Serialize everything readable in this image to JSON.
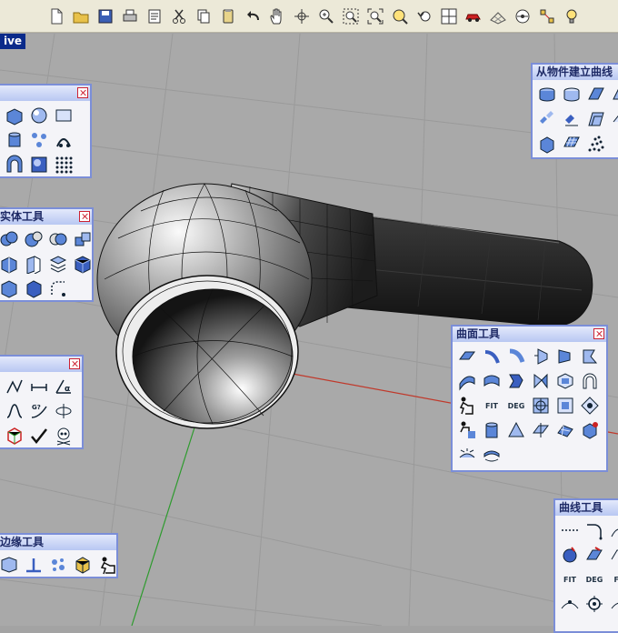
{
  "viewport": {
    "label": "ive"
  },
  "toolbar": {
    "icons": [
      "new-file",
      "open-folder",
      "save",
      "print",
      "properties",
      "cut",
      "copy",
      "paste",
      "undo",
      "pan-hand",
      "rotate-view",
      "zoom-in",
      "zoom-window",
      "zoom-extents",
      "zoom-selected",
      "undo-view",
      "four-viewports",
      "car",
      "grid-snap",
      "record-history",
      "select-points",
      "light-bulb"
    ]
  },
  "palettes": {
    "left1": {
      "title": ""
    },
    "solid": {
      "title": "实体工具"
    },
    "left3": {
      "title": ""
    },
    "edge": {
      "title": "边缘工具"
    },
    "from_object": {
      "title": "从物件建立曲线"
    },
    "surface": {
      "title": "曲面工具",
      "labels": {
        "fit": "FIT",
        "deg": "DEG"
      }
    },
    "curve": {
      "title": "曲线工具",
      "labels": {
        "fit": "FIT",
        "deg": "DEG",
        "ff": "FF"
      }
    }
  },
  "colors": {
    "title_text": "#1e2a66",
    "palette_border": "#7b8ed8",
    "x_axis": "#c0392b",
    "y_axis": "#2e9b2e"
  }
}
